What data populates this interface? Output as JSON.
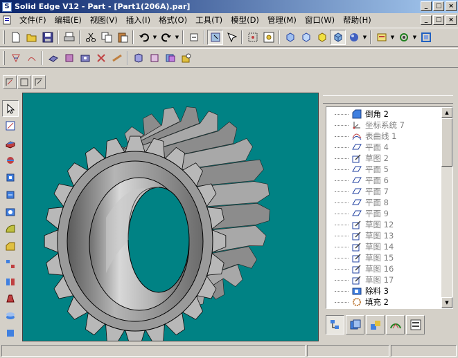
{
  "window": {
    "title": "Solid Edge V12 - Part - [Part1(206A).par]",
    "controls": [
      "_",
      "□",
      "×"
    ]
  },
  "menu": {
    "items": [
      "文件(F)",
      "编辑(E)",
      "视图(V)",
      "插入(I)",
      "格式(O)",
      "工具(T)",
      "模型(D)",
      "管理(M)",
      "窗口(W)",
      "帮助(H)"
    ]
  },
  "mdi_controls": [
    "_",
    "□",
    "×"
  ],
  "toolbar1": {
    "icons": [
      "new-icon",
      "open-icon",
      "save-icon",
      "print-icon",
      "cut-icon",
      "copy-icon",
      "paste-icon",
      "undo-icon",
      "redo-icon",
      "refresh-icon",
      "select-tool-icon",
      "select-filter-icon",
      "view-fit-icon",
      "zoom-area-icon",
      "front-view-icon",
      "back-view-icon",
      "top-view-icon",
      "iso-view-icon",
      "shaded-icon",
      "layer-icon",
      "rotate-icon",
      "pan-icon"
    ]
  },
  "toolbar2": {
    "icons": [
      "feature-library-icon",
      "feature-edit-icon",
      "extrude-icon",
      "revolve-icon",
      "hole-icon",
      "delete-feature-icon",
      "rib-icon",
      "shell-icon",
      "thin-wall-icon",
      "mirror-icon"
    ]
  },
  "small_toolbar": {
    "icons": [
      "profile-icon",
      "sketch-icon",
      "parameter-icon"
    ]
  },
  "left_toolbar": {
    "icons": [
      "select-arrow-icon",
      "smart-dimension-icon",
      "protrusion-icon",
      "revolved-protrusion-icon",
      "cutout-icon",
      "revolved-cutout-icon",
      "hole-feature-icon",
      "round-icon",
      "chamfer-icon",
      "pattern-icon",
      "mirror-feature-icon",
      "draft-icon",
      "thin-part-icon",
      "more-icon"
    ]
  },
  "feature_tree": {
    "rows": [
      {
        "icon": "chamfer-icon",
        "label": "倒角 2",
        "dim": false
      },
      {
        "icon": "coordinate-system-icon",
        "label": "坐标系统 7",
        "dim": true
      },
      {
        "icon": "surface-curve-icon",
        "label": "表曲线 1",
        "dim": true
      },
      {
        "icon": "plane-icon",
        "label": "平面 4",
        "dim": true
      },
      {
        "icon": "sketch-icon",
        "label": "草图 2",
        "dim": true
      },
      {
        "icon": "plane-icon",
        "label": "平面 5",
        "dim": true
      },
      {
        "icon": "plane-icon",
        "label": "平面 6",
        "dim": true
      },
      {
        "icon": "plane-icon",
        "label": "平面 7",
        "dim": true
      },
      {
        "icon": "plane-icon",
        "label": "平面 8",
        "dim": true
      },
      {
        "icon": "plane-icon",
        "label": "平面 9",
        "dim": true
      },
      {
        "icon": "sketch-icon",
        "label": "草图 12",
        "dim": true
      },
      {
        "icon": "sketch-icon",
        "label": "草图 13",
        "dim": true
      },
      {
        "icon": "sketch-icon",
        "label": "草图 14",
        "dim": true
      },
      {
        "icon": "sketch-icon",
        "label": "草图 15",
        "dim": true
      },
      {
        "icon": "sketch-icon",
        "label": "草图 16",
        "dim": true
      },
      {
        "icon": "sketch-icon",
        "label": "草图 17",
        "dim": true
      },
      {
        "icon": "cutout-icon",
        "label": "除料 3",
        "dim": false
      },
      {
        "icon": "fill-icon",
        "label": "填充 2",
        "dim": false
      }
    ]
  },
  "panel_tabs": [
    "feature-pathfinder-icon",
    "features-library-icon",
    "parts-library-icon",
    "layers-icon",
    "smart-tab-icon"
  ],
  "colors": {
    "viewport_bg": "#008284",
    "titlebar_start": "#0a246a",
    "titlebar_end": "#a6caf0",
    "chrome": "#d4d0c8"
  },
  "model": {
    "description_icon": "helical-gear-icon"
  }
}
